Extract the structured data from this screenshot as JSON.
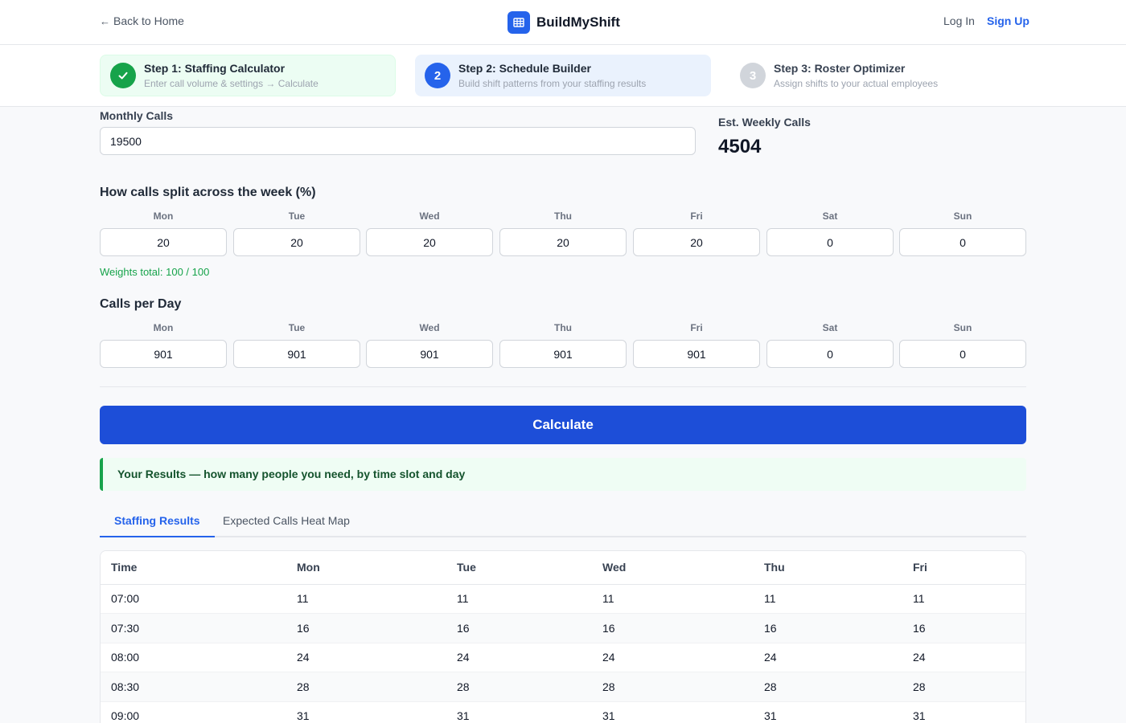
{
  "header": {
    "back_label": "Back to Home",
    "brand_name": "BuildMyShift",
    "login_label": "Log In",
    "signup_label": "Sign Up"
  },
  "steps": [
    {
      "number": "✓",
      "title": "Step 1: Staffing Calculator",
      "subtitle": "Enter call volume & settings → Calculate",
      "status": "complete"
    },
    {
      "number": "2",
      "title": "Step 2: Schedule Builder",
      "subtitle": "Build shift patterns from your staffing results",
      "status": "active"
    },
    {
      "number": "3",
      "title": "Step 3: Roster Optimizer",
      "subtitle": "Assign shifts to your actual employees",
      "status": "pending"
    }
  ],
  "monthly": {
    "label": "Monthly Calls",
    "value": "19500",
    "est_label": "Est. Weekly Calls",
    "est_value": "4504"
  },
  "split": {
    "title": "How calls split across the week (%)",
    "days": [
      {
        "name": "Mon",
        "value": "20"
      },
      {
        "name": "Tue",
        "value": "20"
      },
      {
        "name": "Wed",
        "value": "20"
      },
      {
        "name": "Thu",
        "value": "20"
      },
      {
        "name": "Fri",
        "value": "20"
      },
      {
        "name": "Sat",
        "value": "0"
      },
      {
        "name": "Sun",
        "value": "0"
      }
    ],
    "weights_total": "Weights total: 100 / 100"
  },
  "per_day": {
    "title": "Calls per Day",
    "days": [
      {
        "name": "Mon",
        "value": "901"
      },
      {
        "name": "Tue",
        "value": "901"
      },
      {
        "name": "Wed",
        "value": "901"
      },
      {
        "name": "Thu",
        "value": "901"
      },
      {
        "name": "Fri",
        "value": "901"
      },
      {
        "name": "Sat",
        "value": "0"
      },
      {
        "name": "Sun",
        "value": "0"
      }
    ]
  },
  "calculate_label": "Calculate",
  "results_banner": "Your Results — how many people you need, by time slot and day",
  "tabs": [
    {
      "label": "Staffing Results",
      "active": true
    },
    {
      "label": "Expected Calls Heat Map",
      "active": false
    }
  ],
  "table": {
    "headers": [
      "Time",
      "Mon",
      "Tue",
      "Wed",
      "Thu",
      "Fri"
    ],
    "rows": [
      [
        "07:00",
        "11",
        "11",
        "11",
        "11",
        "11"
      ],
      [
        "07:30",
        "16",
        "16",
        "16",
        "16",
        "16"
      ],
      [
        "08:00",
        "24",
        "24",
        "24",
        "24",
        "24"
      ],
      [
        "08:30",
        "28",
        "28",
        "28",
        "28",
        "28"
      ],
      [
        "09:00",
        "31",
        "31",
        "31",
        "31",
        "31"
      ]
    ]
  },
  "colors": {
    "primary": "#2563eb",
    "button": "#1d4ed8",
    "success": "#16a34a"
  }
}
